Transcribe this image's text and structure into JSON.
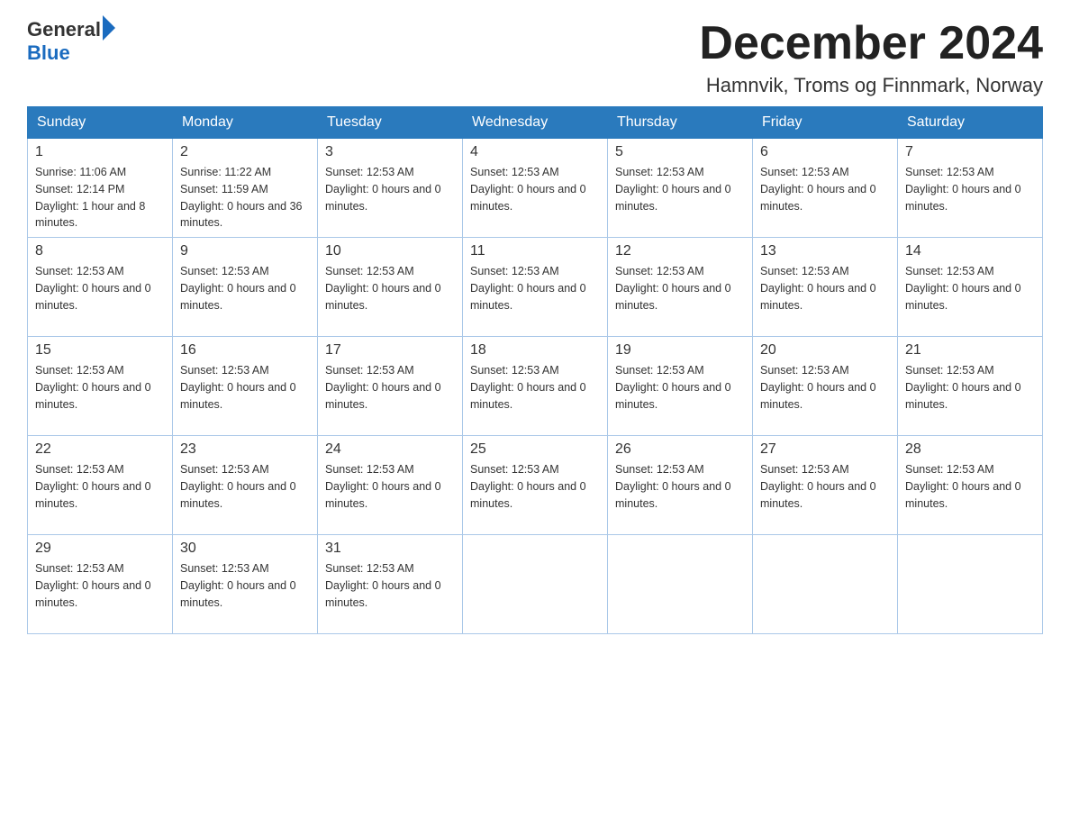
{
  "header": {
    "month_title": "December 2024",
    "location": "Hamnvik, Troms og Finnmark, Norway"
  },
  "logo": {
    "general": "General",
    "blue": "Blue"
  },
  "weekdays": [
    "Sunday",
    "Monday",
    "Tuesday",
    "Wednesday",
    "Thursday",
    "Friday",
    "Saturday"
  ],
  "weeks": [
    {
      "days": [
        {
          "num": "1",
          "info": "Sunrise: 11:06 AM\nSunset: 12:14 PM\nDaylight: 1 hour and 8 minutes."
        },
        {
          "num": "2",
          "info": "Sunrise: 11:22 AM\nSunset: 11:59 AM\nDaylight: 0 hours and 36 minutes."
        },
        {
          "num": "3",
          "info": "Sunset: 12:53 AM\nDaylight: 0 hours and 0 minutes."
        },
        {
          "num": "4",
          "info": "Sunset: 12:53 AM\nDaylight: 0 hours and 0 minutes."
        },
        {
          "num": "5",
          "info": "Sunset: 12:53 AM\nDaylight: 0 hours and 0 minutes."
        },
        {
          "num": "6",
          "info": "Sunset: 12:53 AM\nDaylight: 0 hours and 0 minutes."
        },
        {
          "num": "7",
          "info": "Sunset: 12:53 AM\nDaylight: 0 hours and 0 minutes."
        }
      ]
    },
    {
      "days": [
        {
          "num": "8",
          "info": "Sunset: 12:53 AM\nDaylight: 0 hours and 0 minutes."
        },
        {
          "num": "9",
          "info": "Sunset: 12:53 AM\nDaylight: 0 hours and 0 minutes."
        },
        {
          "num": "10",
          "info": "Sunset: 12:53 AM\nDaylight: 0 hours and 0 minutes."
        },
        {
          "num": "11",
          "info": "Sunset: 12:53 AM\nDaylight: 0 hours and 0 minutes."
        },
        {
          "num": "12",
          "info": "Sunset: 12:53 AM\nDaylight: 0 hours and 0 minutes."
        },
        {
          "num": "13",
          "info": "Sunset: 12:53 AM\nDaylight: 0 hours and 0 minutes."
        },
        {
          "num": "14",
          "info": "Sunset: 12:53 AM\nDaylight: 0 hours and 0 minutes."
        }
      ]
    },
    {
      "days": [
        {
          "num": "15",
          "info": "Sunset: 12:53 AM\nDaylight: 0 hours and 0 minutes."
        },
        {
          "num": "16",
          "info": "Sunset: 12:53 AM\nDaylight: 0 hours and 0 minutes."
        },
        {
          "num": "17",
          "info": "Sunset: 12:53 AM\nDaylight: 0 hours and 0 minutes."
        },
        {
          "num": "18",
          "info": "Sunset: 12:53 AM\nDaylight: 0 hours and 0 minutes."
        },
        {
          "num": "19",
          "info": "Sunset: 12:53 AM\nDaylight: 0 hours and 0 minutes."
        },
        {
          "num": "20",
          "info": "Sunset: 12:53 AM\nDaylight: 0 hours and 0 minutes."
        },
        {
          "num": "21",
          "info": "Sunset: 12:53 AM\nDaylight: 0 hours and 0 minutes."
        }
      ]
    },
    {
      "days": [
        {
          "num": "22",
          "info": "Sunset: 12:53 AM\nDaylight: 0 hours and 0 minutes."
        },
        {
          "num": "23",
          "info": "Sunset: 12:53 AM\nDaylight: 0 hours and 0 minutes."
        },
        {
          "num": "24",
          "info": "Sunset: 12:53 AM\nDaylight: 0 hours and 0 minutes."
        },
        {
          "num": "25",
          "info": "Sunset: 12:53 AM\nDaylight: 0 hours and 0 minutes."
        },
        {
          "num": "26",
          "info": "Sunset: 12:53 AM\nDaylight: 0 hours and 0 minutes."
        },
        {
          "num": "27",
          "info": "Sunset: 12:53 AM\nDaylight: 0 hours and 0 minutes."
        },
        {
          "num": "28",
          "info": "Sunset: 12:53 AM\nDaylight: 0 hours and 0 minutes."
        }
      ]
    },
    {
      "days": [
        {
          "num": "29",
          "info": "Sunset: 12:53 AM\nDaylight: 0 hours and 0 minutes."
        },
        {
          "num": "30",
          "info": "Sunset: 12:53 AM\nDaylight: 0 hours and 0 minutes."
        },
        {
          "num": "31",
          "info": "Sunset: 12:53 AM\nDaylight: 0 hours and 0 minutes."
        },
        {
          "num": "",
          "info": ""
        },
        {
          "num": "",
          "info": ""
        },
        {
          "num": "",
          "info": ""
        },
        {
          "num": "",
          "info": ""
        }
      ]
    }
  ]
}
